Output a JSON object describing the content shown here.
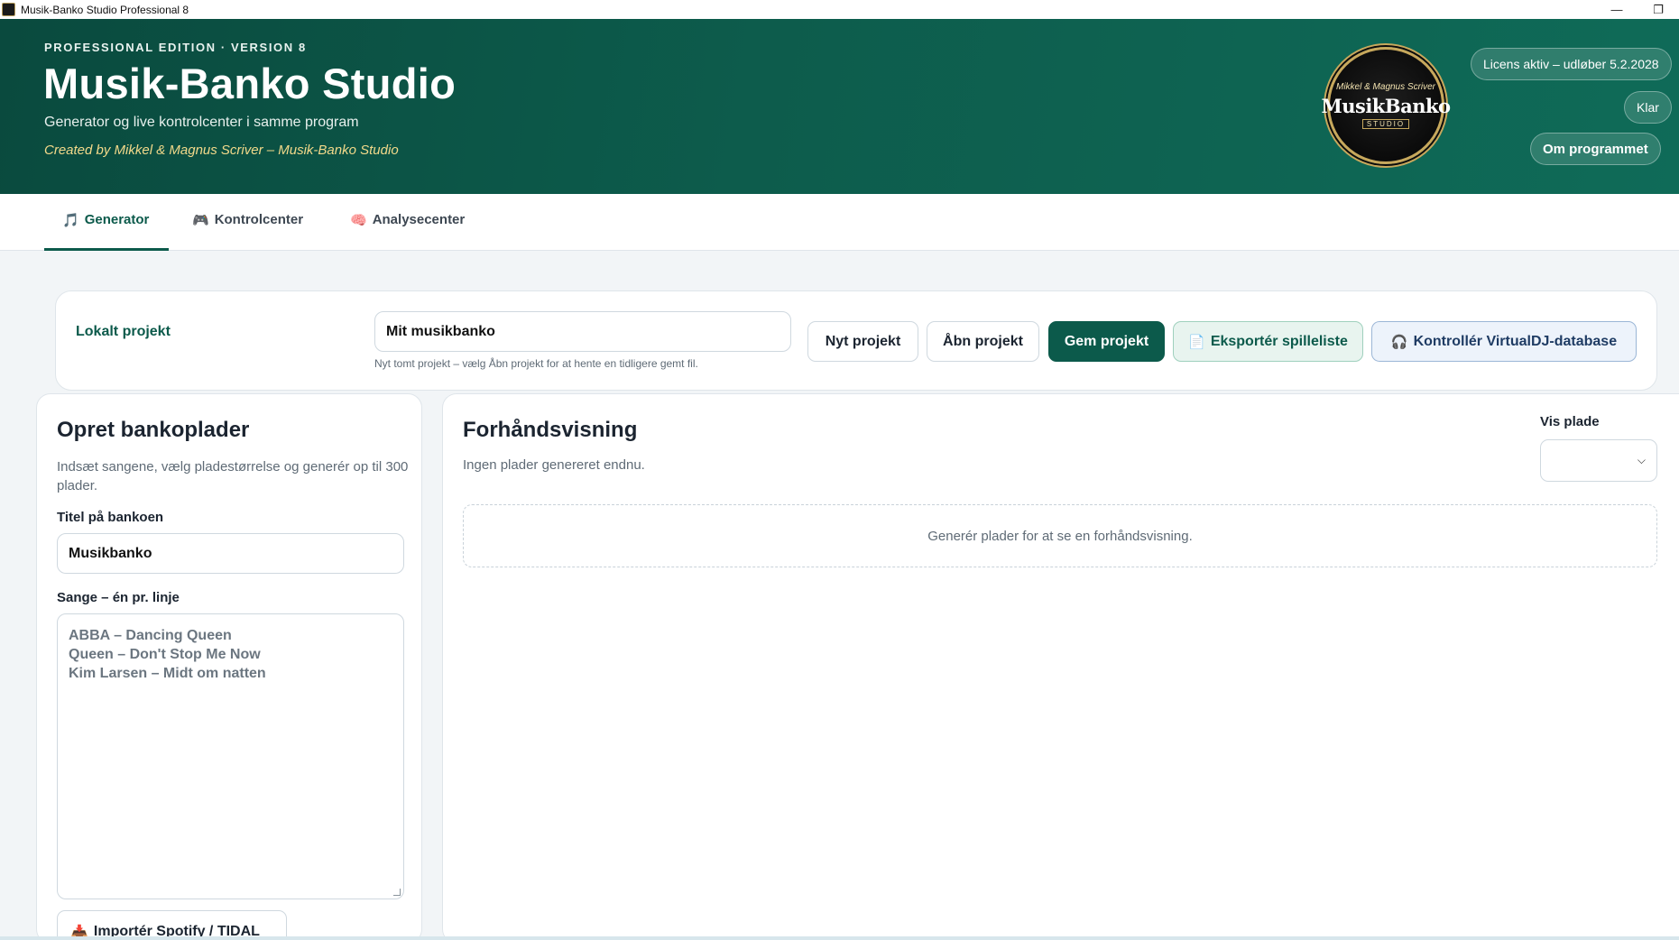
{
  "window": {
    "title": "Musik-Banko Studio Professional 8",
    "minimize_glyph": "—",
    "restore_glyph": "❐"
  },
  "header": {
    "edition": "PROFESSIONAL EDITION · VERSION 8",
    "title": "Musik-Banko Studio",
    "subtitle": "Generator og live kontrolcenter i samme program",
    "credits": "Created by Mikkel & Magnus Scriver – Musik-Banko Studio",
    "logo": {
      "small_text": "Mikkel & Magnus Scriver",
      "main_text": "MusikBanko",
      "sub_text": "STUDIO"
    },
    "license": "Licens aktiv – udløber 5.2.2028",
    "status": "Klar",
    "about_button": "Om programmet",
    "colors": {
      "header_dark": "#0a4a3e",
      "header_light": "#0f6b58",
      "accent_gold": "#f2d98a"
    }
  },
  "tabs": [
    {
      "label": "Generator",
      "icon": "music-note-icon",
      "glyph": "🎵",
      "active": true
    },
    {
      "label": "Kontrolcenter",
      "icon": "gamepad-icon",
      "glyph": "🎮",
      "active": false
    },
    {
      "label": "Analysecenter",
      "icon": "brain-icon",
      "glyph": "🧠",
      "active": false
    }
  ],
  "project": {
    "label": "Lokalt projekt",
    "name_value": "Mit musikbanko",
    "hint": "Nyt tomt projekt – vælg Åbn projekt for at hente en tidligere gemt fil.",
    "buttons": {
      "new": "Nyt projekt",
      "open": "Åbn projekt",
      "save": "Gem projekt",
      "export": "Eksportér spilleliste",
      "export_glyph": "📄",
      "vdj": "Kontrollér VirtualDJ-database",
      "vdj_glyph": "🎧"
    },
    "colors": {
      "primary": "#0c5a4b"
    }
  },
  "create": {
    "heading": "Opret bankoplader",
    "description": "Indsæt sangene, vælg pladestørrelse og generér op til 300 plader.",
    "title_label": "Titel på bankoen",
    "title_value": "Musikbanko",
    "songs_label": "Sange – én pr. linje",
    "songs_placeholder": [
      "ABBA – Dancing Queen",
      "Queen – Don't Stop Me Now",
      "Kim Larsen – Midt om natten"
    ],
    "import_button": "Importér Spotify / TIDAL",
    "import_glyph": "📥"
  },
  "preview": {
    "heading": "Forhåndsvisning",
    "none_text": "Ingen plader genereret endnu.",
    "show_label": "Vis plade",
    "selected_value": "",
    "empty_message": "Generér plader for at se en forhåndsvisning."
  }
}
